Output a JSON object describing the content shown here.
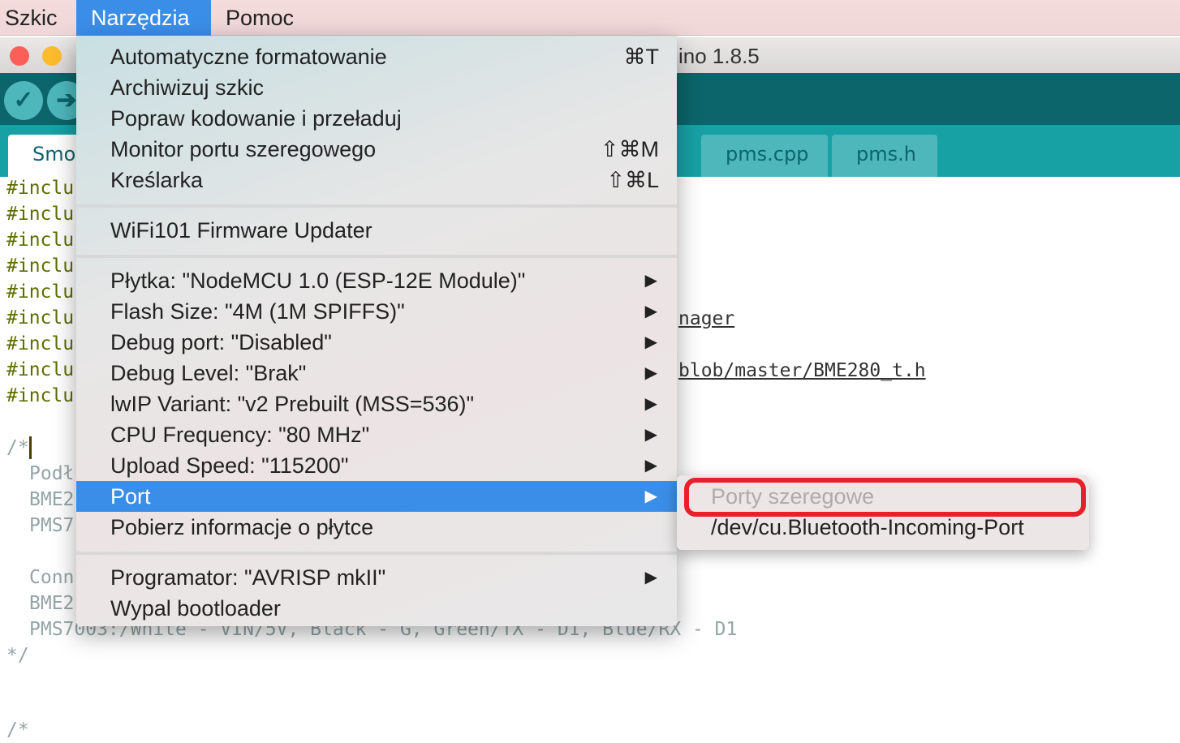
{
  "menubar": {
    "items": [
      "Szkic",
      "Narzędzia",
      "Pomoc"
    ]
  },
  "window": {
    "title_fragment": "ino 1.8.5"
  },
  "toolbar": {
    "verify_icon": "check-icon",
    "upload_icon": "arrow-right-icon"
  },
  "tabs": [
    "Smog",
    "pms.cpp",
    "pms.h"
  ],
  "editor": {
    "include_fragment": "#inclu",
    "right_fragments": [
      "nager",
      "blob/master/BME280_t.h"
    ],
    "comment_open": "/*",
    "comment_left": [
      "Podł",
      "BME2",
      "PMS7",
      "Conn",
      "BME2"
    ],
    "pms_line": "PMS7003:/White - VIN/5V, Black - G, Green/TX - D1, Blue/RX - D1",
    "comment_close": "*/",
    "comment_open2": "/*"
  },
  "menu": {
    "group1": [
      {
        "label": "Automatyczne formatowanie",
        "shortcut": "⌘T"
      },
      {
        "label": "Archiwizuj szkic",
        "shortcut": ""
      },
      {
        "label": "Popraw kodowanie i przeładuj",
        "shortcut": ""
      },
      {
        "label": "Monitor portu szeregowego",
        "shortcut": "⇧⌘M"
      },
      {
        "label": "Kreślarka",
        "shortcut": "⇧⌘L"
      }
    ],
    "group2": [
      {
        "label": "WiFi101 Firmware Updater"
      }
    ],
    "group3": [
      {
        "label": "Płytka: \"NodeMCU 1.0 (ESP-12E Module)\""
      },
      {
        "label": "Flash Size: \"4M (1M SPIFFS)\""
      },
      {
        "label": "Debug port: \"Disabled\""
      },
      {
        "label": "Debug Level: \"Brak\""
      },
      {
        "label": "lwIP Variant: \"v2 Prebuilt (MSS=536)\""
      },
      {
        "label": "CPU Frequency: \"80 MHz\""
      },
      {
        "label": "Upload Speed: \"115200\""
      },
      {
        "label": "Port"
      },
      {
        "label": "Pobierz informacje o płytce"
      }
    ],
    "group4": [
      {
        "label": "Programator: \"AVRISP mkII\""
      },
      {
        "label": "Wypal bootloader"
      }
    ],
    "arrow": "▶"
  },
  "submenu": {
    "header": "Porty szeregowe",
    "items": [
      "/dev/cu.Bluetooth-Incoming-Port"
    ]
  },
  "colors": {
    "highlight": "#3b8ee8",
    "annotation": "#e8202a",
    "toolbar": "#0c656a"
  }
}
